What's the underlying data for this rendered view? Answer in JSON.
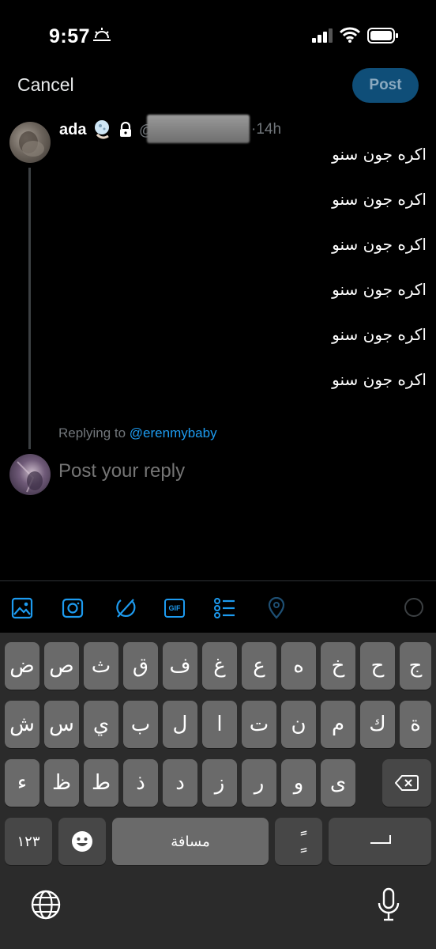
{
  "status_bar": {
    "time": "9:57"
  },
  "header": {
    "cancel_label": "Cancel",
    "post_label": "Post"
  },
  "original_post": {
    "author_name": "ada",
    "at_sign": "@",
    "time_label": "·14h",
    "lines": [
      "اكره جون سنو",
      "اكره جون سنو",
      "اكره جون سنو",
      "اكره جون سنو",
      "اكره جون سنو",
      "اكره جون سنو"
    ]
  },
  "reply": {
    "replying_to_prefix": "Replying to ",
    "replying_to_handle": "@erenmybaby",
    "placeholder": "Post your reply"
  },
  "toolbar": {
    "icons": [
      "image-icon",
      "camera-icon",
      "grok-icon",
      "gif-icon",
      "poll-icon",
      "location-icon"
    ],
    "gif_label": "GIF"
  },
  "keyboard": {
    "row1": [
      "ض",
      "ص",
      "ث",
      "ق",
      "ف",
      "غ",
      "ع",
      "ه",
      "خ",
      "ح",
      "ج"
    ],
    "row2": [
      "ش",
      "س",
      "ي",
      "ب",
      "ل",
      "ا",
      "ت",
      "ن",
      "م",
      "ك",
      "ة"
    ],
    "row3": [
      "ء",
      "ظ",
      "ط",
      "ذ",
      "د",
      "ز",
      "ر",
      "و",
      "ى"
    ],
    "numbers_label": "١٢٣",
    "space_label": "مسافة",
    "diacritic_label": "ًٍ"
  },
  "colors": {
    "accent": "#1d9bf0",
    "post_button_bg": "#0f4e78",
    "keyboard_bg": "#2b2b2b",
    "key_bg": "#6a6a6a"
  }
}
